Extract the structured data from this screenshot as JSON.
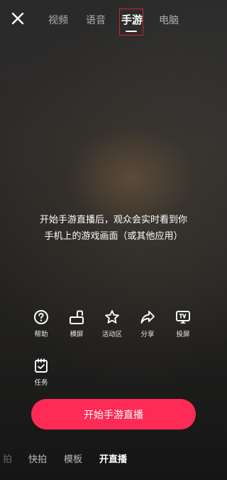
{
  "header": {
    "tabs": [
      {
        "label": "视频"
      },
      {
        "label": "语音"
      },
      {
        "label": "手游"
      },
      {
        "label": "电脑"
      }
    ]
  },
  "hint": {
    "line1": "开始手游直播后，观众会实时看到你",
    "line2": "手机上的游戏画面（或其他应用）"
  },
  "tools": [
    {
      "label": "帮助",
      "icon": "help-icon"
    },
    {
      "label": "横屏",
      "icon": "landscape-icon"
    },
    {
      "label": "活动区",
      "icon": "star-icon"
    },
    {
      "label": "分享",
      "icon": "share-icon"
    },
    {
      "label": "投屏",
      "icon": "tv-icon"
    },
    {
      "label": "任务",
      "icon": "task-icon"
    }
  ],
  "start_button": {
    "label": "开始手游直播"
  },
  "bottom_nav": [
    {
      "label": "拍"
    },
    {
      "label": "快拍"
    },
    {
      "label": "模板"
    },
    {
      "label": "开直播"
    }
  ],
  "colors": {
    "accent": "#fd2b55",
    "highlight": "#c8272d"
  }
}
